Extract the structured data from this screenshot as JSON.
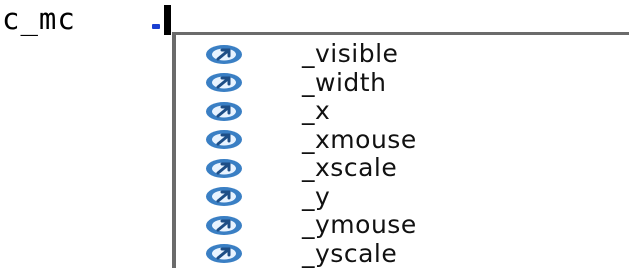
{
  "editor": {
    "code_text": "c_mc",
    "accent_color": "#1a3fd1"
  },
  "completion": {
    "icon_name": "property-icon",
    "icon_color": "#2f6fb8",
    "items": [
      {
        "label": "_visible"
      },
      {
        "label": "_width"
      },
      {
        "label": "_x"
      },
      {
        "label": "_xmouse"
      },
      {
        "label": "_xscale"
      },
      {
        "label": "_y"
      },
      {
        "label": "_ymouse"
      },
      {
        "label": "_yscale"
      }
    ]
  }
}
